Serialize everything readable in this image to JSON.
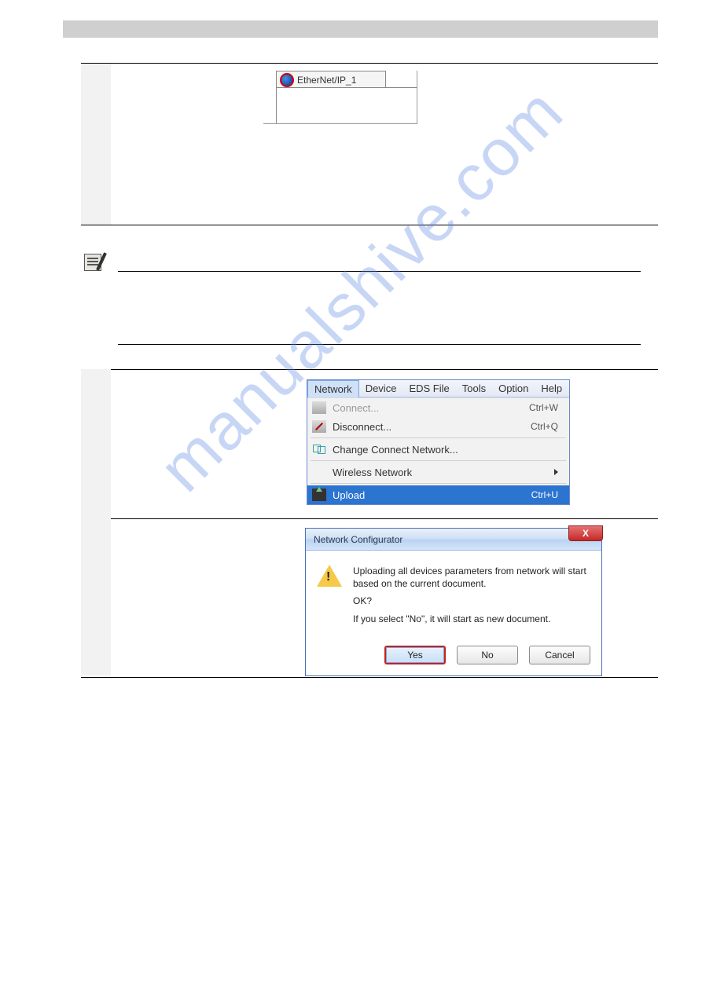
{
  "watermark": "manualshive.com",
  "tab": {
    "label": "EtherNet/IP_1"
  },
  "menu": {
    "bar": {
      "network": "Network",
      "device": "Device",
      "eds": "EDS File",
      "tools": "Tools",
      "option": "Option",
      "help": "Help"
    },
    "items": {
      "connect": {
        "label": "Connect...",
        "shortcut": "Ctrl+W"
      },
      "disconnect": {
        "label": "Disconnect...",
        "shortcut": "Ctrl+Q"
      },
      "change_network": {
        "label": "Change Connect Network..."
      },
      "wireless": {
        "label": "Wireless Network"
      },
      "upload": {
        "label": "Upload",
        "shortcut": "Ctrl+U"
      }
    }
  },
  "dialog": {
    "title": "Network Configurator",
    "line1": "Uploading all devices parameters from network will start based on the current document.",
    "line2": "OK?",
    "line3": "If you select \"No\", it will start as new document.",
    "buttons": {
      "yes": "Yes",
      "no": "No",
      "cancel": "Cancel"
    },
    "close": "X"
  }
}
